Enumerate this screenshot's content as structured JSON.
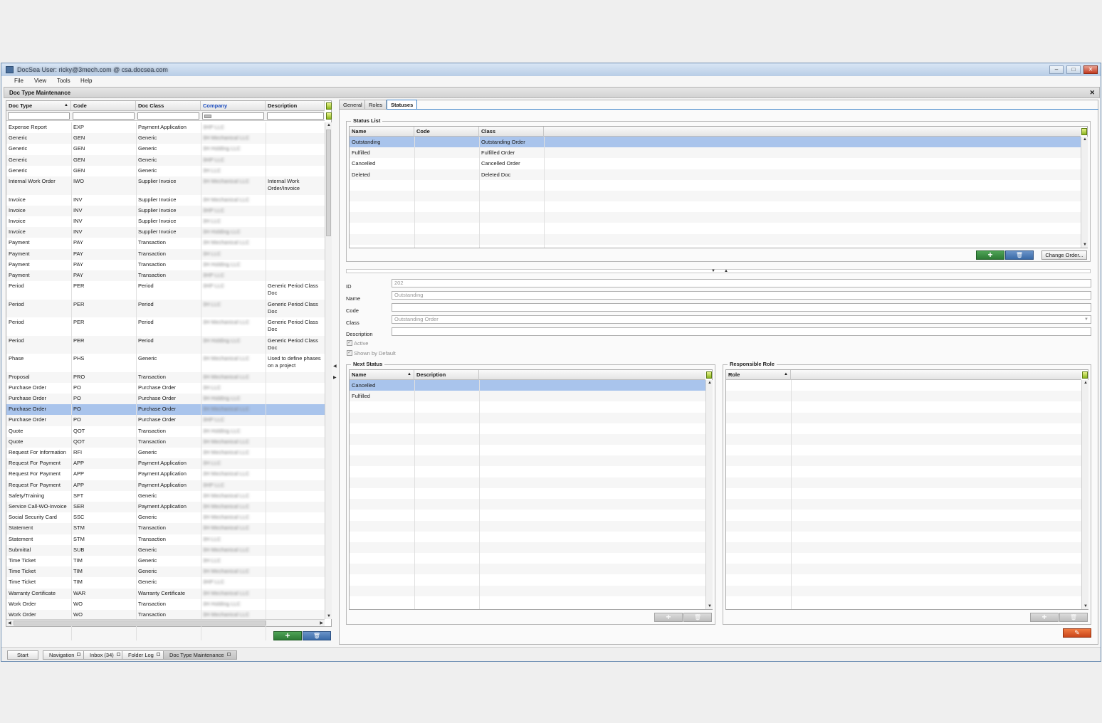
{
  "window": {
    "title": "DocSea   User: ricky@3mech.com @ csa.docsea.com"
  },
  "menu": [
    "File",
    "View",
    "Tools",
    "Help"
  ],
  "panel_title": "Doc Type Maintenance",
  "left_grid": {
    "columns": [
      "Doc Type",
      "Code",
      "Doc Class",
      "Company",
      "Description"
    ],
    "rows": [
      [
        "Expense Report",
        "EXP",
        "Payment Application",
        "3HP LLC",
        ""
      ],
      [
        "Generic",
        "GEN",
        "Generic",
        "3H Mechanical LLC",
        ""
      ],
      [
        "Generic",
        "GEN",
        "Generic",
        "3H Holding LLC",
        ""
      ],
      [
        "Generic",
        "GEN",
        "Generic",
        "3HP LLC",
        ""
      ],
      [
        "Generic",
        "GEN",
        "Generic",
        "3H LLC",
        ""
      ],
      [
        "Internal Work Order",
        "IWO",
        "Supplier Invoice",
        "3H Mechanical LLC",
        "Internal Work Order/Invoice"
      ],
      [
        "Invoice",
        "INV",
        "Supplier Invoice",
        "3H Mechanical LLC",
        ""
      ],
      [
        "Invoice",
        "INV",
        "Supplier Invoice",
        "3HP LLC",
        ""
      ],
      [
        "Invoice",
        "INV",
        "Supplier Invoice",
        "3H LLC",
        ""
      ],
      [
        "Invoice",
        "INV",
        "Supplier Invoice",
        "3H Holding LLC",
        ""
      ],
      [
        "Payment",
        "PAY",
        "Transaction",
        "3H Mechanical LLC",
        ""
      ],
      [
        "Payment",
        "PAY",
        "Transaction",
        "3H LLC",
        ""
      ],
      [
        "Payment",
        "PAY",
        "Transaction",
        "3H Holding LLC",
        ""
      ],
      [
        "Payment",
        "PAY",
        "Transaction",
        "3HP LLC",
        ""
      ],
      [
        "Period",
        "PER",
        "Period",
        "3HP LLC",
        "Generic Period Class Doc"
      ],
      [
        "Period",
        "PER",
        "Period",
        "3H LLC",
        "Generic Period Class Doc"
      ],
      [
        "Period",
        "PER",
        "Period",
        "3H Mechanical LLC",
        "Generic Period Class Doc"
      ],
      [
        "Period",
        "PER",
        "Period",
        "3H Holding LLC",
        "Generic Period Class Doc"
      ],
      [
        "Phase",
        "PHS",
        "Generic",
        "3H Mechanical LLC",
        "Used to define phases on a project"
      ],
      [
        "Proposal",
        "PRO",
        "Transaction",
        "3H Mechanical LLC",
        ""
      ],
      [
        "Purchase Order",
        "PO",
        "Purchase Order",
        "3H LLC",
        ""
      ],
      [
        "Purchase Order",
        "PO",
        "Purchase Order",
        "3H Holding LLC",
        ""
      ],
      [
        "Purchase Order",
        "PO",
        "Purchase Order",
        "3H Mechanical LLC",
        ""
      ],
      [
        "Purchase Order",
        "PO",
        "Purchase Order",
        "3HP LLC",
        ""
      ],
      [
        "Quote",
        "QOT",
        "Transaction",
        "3H Holding LLC",
        ""
      ],
      [
        "Quote",
        "QOT",
        "Transaction",
        "3H Mechanical LLC",
        ""
      ],
      [
        "Request For Information",
        "RFI",
        "Generic",
        "3H Mechanical LLC",
        ""
      ],
      [
        "Request For Payment",
        "APP",
        "Payment Application",
        "3H LLC",
        ""
      ],
      [
        "Request For Payment",
        "APP",
        "Payment Application",
        "3H Mechanical LLC",
        ""
      ],
      [
        "Request For Payment",
        "APP",
        "Payment Application",
        "3HP LLC",
        ""
      ],
      [
        "Safety/Training",
        "SFT",
        "Generic",
        "3H Mechanical LLC",
        ""
      ],
      [
        "Service Call-WO-Invoice",
        "SER",
        "Payment Application",
        "3H Mechanical LLC",
        ""
      ],
      [
        "Social Security Card",
        "SSC",
        "Generic",
        "3H Mechanical LLC",
        ""
      ],
      [
        "Statement",
        "STM",
        "Transaction",
        "3H Mechanical LLC",
        ""
      ],
      [
        "Statement",
        "STM",
        "Transaction",
        "3H LLC",
        ""
      ],
      [
        "Submittal",
        "SUB",
        "Generic",
        "3H Mechanical LLC",
        ""
      ],
      [
        "Time Ticket",
        "TIM",
        "Generic",
        "3H LLC",
        ""
      ],
      [
        "Time Ticket",
        "TIM",
        "Generic",
        "3H Mechanical LLC",
        ""
      ],
      [
        "Time Ticket",
        "TIM",
        "Generic",
        "3HP LLC",
        ""
      ],
      [
        "Warranty Certificate",
        "WAR",
        "Warranty Certificate",
        "3H Mechanical LLC",
        ""
      ],
      [
        "Work Order",
        "WO",
        "Transaction",
        "3H Holding LLC",
        ""
      ],
      [
        "Work Order",
        "WO",
        "Transaction",
        "3H Mechanical LLC",
        ""
      ]
    ],
    "selected_row": 22
  },
  "tabs": [
    "General",
    "Roles",
    "Statuses"
  ],
  "active_tab": "Statuses",
  "status_list": {
    "legend": "Status List",
    "columns": [
      "Name",
      "Code",
      "Class"
    ],
    "rows": [
      [
        "Outstanding",
        "",
        "Outstanding Order"
      ],
      [
        "Fulfilled",
        "",
        "Fulfilled Order"
      ],
      [
        "Cancelled",
        "",
        "Cancelled Order"
      ],
      [
        "Deleted",
        "",
        "Deleted Doc"
      ]
    ],
    "change_order_label": "Change Order..."
  },
  "form": {
    "id_label": "ID",
    "id_value": "202",
    "name_label": "Name",
    "name_value": "Outstanding",
    "code_label": "Code",
    "code_value": "",
    "class_label": "Class",
    "class_value": "Outstanding Order",
    "description_label": "Description",
    "description_value": "",
    "active_label": "Active",
    "shown_default_label": "Shown by Default"
  },
  "next_status": {
    "legend": "Next Status",
    "columns": [
      "Name",
      "Description"
    ],
    "rows": [
      [
        "Cancelled",
        ""
      ],
      [
        "Fulfilled",
        ""
      ]
    ]
  },
  "responsible_role": {
    "legend": "Responsible Role",
    "columns": [
      "Role"
    ]
  },
  "taskbar": [
    "Start",
    "Navigation",
    "Inbox (34)",
    "Folder Log",
    "Doc Type Maintenance"
  ],
  "colors": {
    "selection": "#a9c4ec",
    "add": "#2d7a35",
    "delete": "#3a6aa7",
    "edit": "#c9461a"
  }
}
